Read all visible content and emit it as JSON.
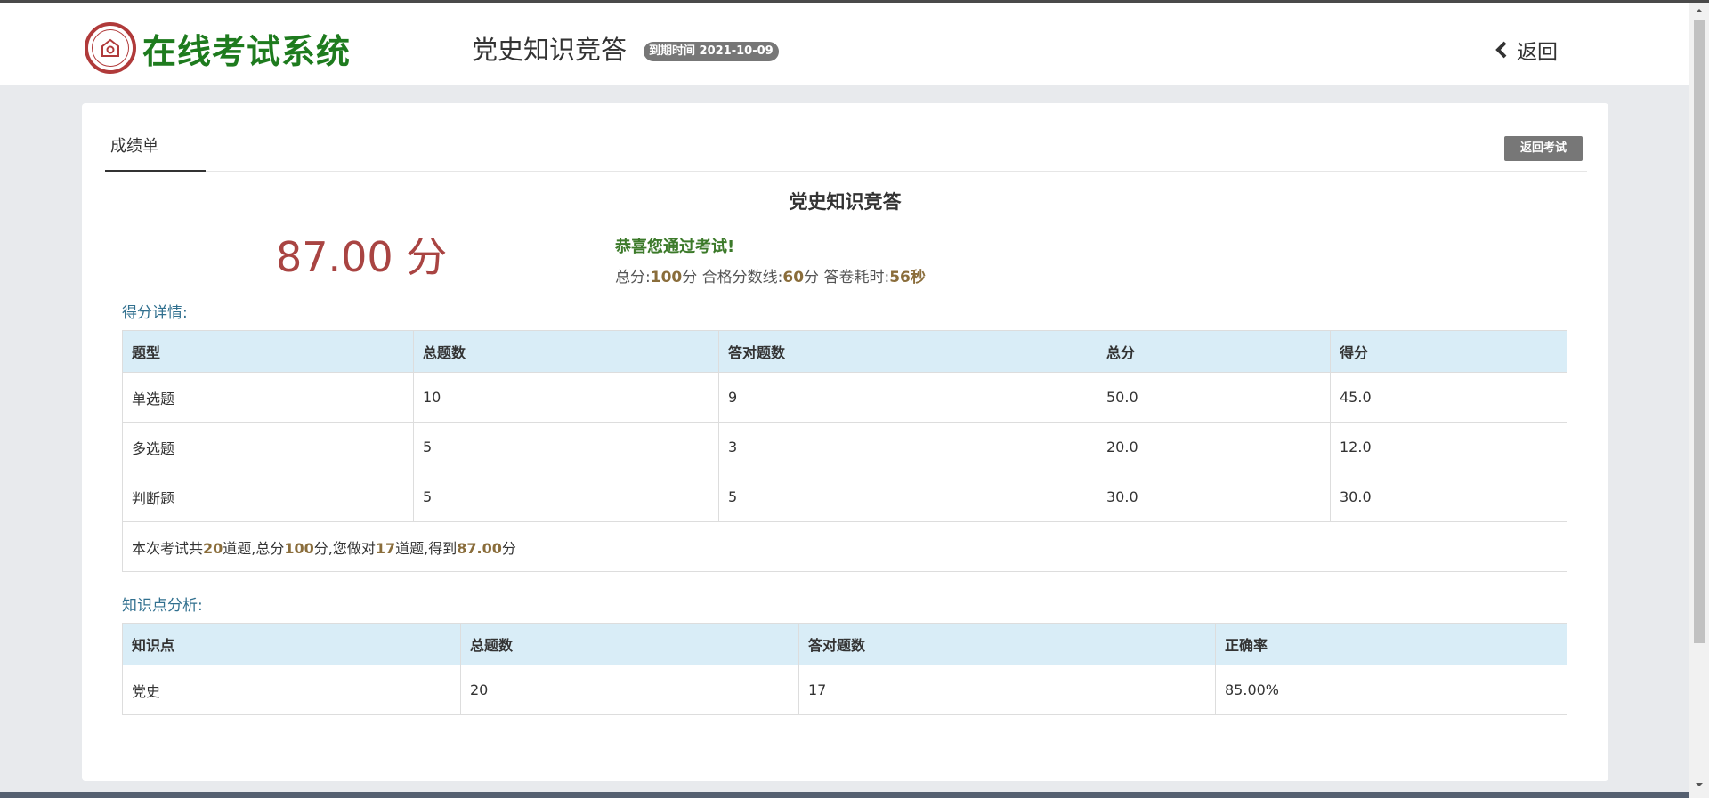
{
  "header": {
    "logo_text": "在线考试系统",
    "exam_title": "党史知识竞答",
    "deadline_badge": "到期时间 2021-10-09",
    "back_label": "返回"
  },
  "tabs": {
    "active_label": "成绩单"
  },
  "toolbar": {
    "return_exam_label": "返回考试"
  },
  "result": {
    "title": "党史知识竞答",
    "score_text": "87.00 分",
    "pass_message": "恭喜您通过考试!",
    "summary": {
      "total_label": "总分:",
      "total_value": "100",
      "total_unit": "分",
      "pass_label": " 合格分数线:",
      "pass_value": "60",
      "pass_unit": "分",
      "time_label": " 答卷耗时:",
      "time_value": "56秒"
    }
  },
  "score_detail": {
    "label": "得分详情:",
    "headers": [
      "题型",
      "总题数",
      "答对题数",
      "总分",
      "得分"
    ],
    "rows": [
      [
        "单选题",
        "10",
        "9",
        "50.0",
        "45.0"
      ],
      [
        "多选题",
        "5",
        "3",
        "20.0",
        "12.0"
      ],
      [
        "判断题",
        "5",
        "5",
        "30.0",
        "30.0"
      ]
    ],
    "note": {
      "p1": "本次考试共",
      "count": "20",
      "p2": "道题,总分",
      "total": "100",
      "p3": "分,您做对",
      "correct": "17",
      "p4": "道题,得到",
      "score": "87.00",
      "p5": "分"
    }
  },
  "knowledge": {
    "label": "知识点分析:",
    "headers": [
      "知识点",
      "总题数",
      "答对题数",
      "正确率"
    ],
    "rows": [
      [
        "党史",
        "20",
        "17",
        "85.00%"
      ]
    ]
  },
  "colors": {
    "brand_green": "#1e7b1e",
    "score_red": "#a94442",
    "pass_green": "#3c7a2a",
    "highlight_brown": "#8a6d3b",
    "table_header_bg": "#d9edf7",
    "section_label_blue": "#31708f"
  }
}
